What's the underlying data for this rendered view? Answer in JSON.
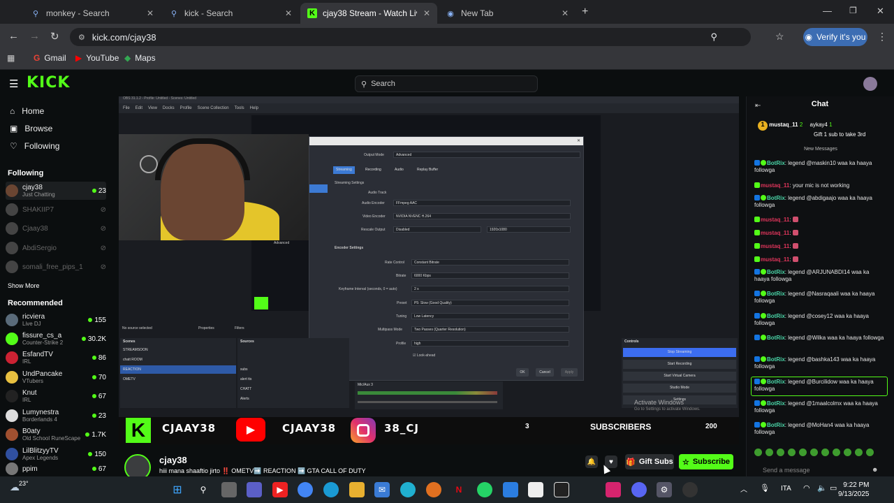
{
  "browser": {
    "tabs": [
      {
        "title": "monkey - Search",
        "icon": "search-icon"
      },
      {
        "title": "kick - Search",
        "icon": "search-icon"
      },
      {
        "title": "cjay38 Stream - Watch Live on",
        "icon": "kick-logo-icon"
      },
      {
        "title": "New Tab",
        "icon": "globe-icon"
      }
    ],
    "new_tab_symbol": "+",
    "url": "kick.com/cjay38",
    "verify_label": "Verify it's you",
    "bookmarks": [
      "Gmail",
      "YouTube",
      "Maps"
    ]
  },
  "kick": {
    "logo": "KICK",
    "search_placeholder": "Search",
    "nav": [
      {
        "label": "Home",
        "icon": "home-icon"
      },
      {
        "label": "Browse",
        "icon": "browse-icon"
      },
      {
        "label": "Following",
        "icon": "heart-icon"
      }
    ],
    "following_heading": "Following",
    "following": [
      {
        "name": "cjay38",
        "sub": "Just Chatting",
        "viewers": "23",
        "live": true
      },
      {
        "name": "SHAKIIP7",
        "sub": "",
        "viewers": "",
        "live": false
      },
      {
        "name": "Cjaay38",
        "sub": "",
        "viewers": "",
        "live": false
      },
      {
        "name": "AbdiSergio",
        "sub": "",
        "viewers": "",
        "live": false
      },
      {
        "name": "somali_free_pips_1",
        "sub": "",
        "viewers": "",
        "live": false
      }
    ],
    "show_more": "Show More",
    "recommended_heading": "Recommended",
    "recommended": [
      {
        "name": "ricviera",
        "sub": "Live DJ",
        "viewers": "155"
      },
      {
        "name": "fissure_cs_a",
        "sub": "Counter-Strike 2",
        "viewers": "30.2K"
      },
      {
        "name": "EsfandTV",
        "sub": "IRL",
        "viewers": "86"
      },
      {
        "name": "UndPancake",
        "sub": "VTubers",
        "viewers": "70"
      },
      {
        "name": "Knut",
        "sub": "IRL",
        "viewers": "67"
      },
      {
        "name": "Lumynestra",
        "sub": "Borderlands 4",
        "viewers": "23"
      },
      {
        "name": "B0aty",
        "sub": "Old School RuneScape",
        "viewers": "1.7K"
      },
      {
        "name": "LilBlitzyyTV",
        "sub": "Apex Legends",
        "viewers": "150"
      },
      {
        "name": "ppim",
        "sub": "",
        "viewers": "67"
      }
    ]
  },
  "stream": {
    "obs_title": "OBS 31.1.2 - Profile: Untitled - Scenes: Untitled",
    "obs_menu": [
      "File",
      "Edit",
      "View",
      "Docks",
      "Profile",
      "Scene Collection",
      "Tools",
      "Help"
    ],
    "dialog": {
      "output_mode_label": "Output Mode",
      "output_mode_value": "Advanced",
      "tabs": [
        "Streaming",
        "Recording",
        "Audio",
        "Replay Buffer"
      ],
      "streaming_settings": "Streaming Settings",
      "audio_track_label": "Audio Track",
      "audio_encoder_label": "Audio Encoder",
      "audio_encoder_value": "FFmpeg AAC",
      "video_encoder_label": "Video Encoder",
      "video_encoder_value": "NVIDIA NVENC H.264",
      "rescale_label": "Rescale Output",
      "rescale_value": "Disabled",
      "rescale_res": "1920x1080",
      "encoder_settings": "Encoder Settings",
      "rows": [
        {
          "label": "Rate Control",
          "value": "Constant Bitrate"
        },
        {
          "label": "Bitrate",
          "value": "6000 Kbps"
        },
        {
          "label": "Keyframe Interval (seconds, 0 = auto)",
          "value": "2 s"
        },
        {
          "label": "Preset",
          "value": "P5: Slow (Good Quality)"
        },
        {
          "label": "Tuning",
          "value": "Low Latency"
        },
        {
          "label": "Multipass Mode",
          "value": "Two Passes (Quarter Resolution)"
        },
        {
          "label": "Profile",
          "value": "high"
        }
      ],
      "lookahead": "Look-ahead",
      "ok": "OK",
      "cancel": "Cancel",
      "apply": "Apply",
      "advanced": "Advanced"
    },
    "no_source": "No source selected",
    "properties": "Properties",
    "filters": "Filters",
    "scenes_label": "Scenes",
    "scenes": [
      "STREAMSOON",
      "chatt ROOM",
      "REACTION",
      "OMETV"
    ],
    "active_scene": 2,
    "sources_label": "Sources",
    "sources": [
      "subs",
      "alert tts",
      "CHATT",
      "Alerts"
    ],
    "mixer_label": "Mic/Aux 3",
    "controls_label": "Controls",
    "controls": [
      "Stop Streaming",
      "Start Recording",
      "Start Virtual Camera",
      "Studio Mode",
      "Settings"
    ],
    "activate_windows": "Activate Windows",
    "activate_windows_sub": "Go to Settings to activate Windows.",
    "banner": {
      "kick_handle": "CJAAY38",
      "yt_handle": "CJAAY38",
      "ig_handle": "38_CJ",
      "count_left": "3",
      "subscribers": "SUBSCRIBERS",
      "count_right": "200"
    }
  },
  "channel": {
    "name": "cjay38",
    "title": "hiii mana shaaftio jirto ‼️ OMETV➡️ REACTION ➡️ GTA CALL OF DUTY",
    "gift_label": "Gift Subs",
    "subscribe_label": "Subscribe"
  },
  "chat": {
    "heading": "Chat",
    "pinned": {
      "user1": "mustaq_11",
      "count1": "2",
      "user2": "aykay4",
      "count2": "1",
      "text": "Gift 1 sub to take 3rd"
    },
    "new_messages": "New Messages",
    "messages": [
      {
        "user": "BotRix",
        "text": "legend @maskin10 waa ka haaya followga",
        "color": "#4ad6a8"
      },
      {
        "user": "mustaq_11",
        "text": "your mic is not working",
        "color": "#e0355b"
      },
      {
        "user": "BotRix",
        "text": "legend @abdigaajo waa ka haaya followga",
        "color": "#4ad6a8"
      },
      {
        "user": "mustaq_11",
        "text": "",
        "color": "#e0355b"
      },
      {
        "user": "mustaq_11",
        "text": "",
        "color": "#e0355b"
      },
      {
        "user": "mustaq_11",
        "text": "",
        "color": "#e0355b"
      },
      {
        "user": "mustaq_11",
        "text": "",
        "color": "#e0355b"
      },
      {
        "user": "BotRix",
        "text": "legend @ARJUNABDI14 waa ka haaya followga",
        "color": "#4ad6a8"
      },
      {
        "user": "BotRix",
        "text": "legend @Nasraqaali waa ka haaya followga",
        "color": "#4ad6a8"
      },
      {
        "user": "BotRix",
        "text": "legend @cosey12 waa ka haaya followga",
        "color": "#4ad6a8"
      },
      {
        "user": "BotRix",
        "text": "legend @Wilka waa ka haaya followga",
        "color": "#4ad6a8"
      },
      {
        "user": "BotRix",
        "text": "legend @bashka143 waa ka haaya followga",
        "color": "#4ad6a8"
      },
      {
        "user": "BotRix",
        "text": "legend @Burcilidow waa ka haaya followga",
        "color": "#4ad6a8"
      },
      {
        "user": "BotRix",
        "text": "legend @1maalcolmx waa ka haaya followga",
        "color": "#4ad6a8"
      },
      {
        "user": "BotRix",
        "text": "legend @MoHan4 waa ka haaya followga",
        "color": "#4ad6a8"
      }
    ],
    "send_placeholder": "Send a message"
  },
  "taskbar": {
    "temp": "23°",
    "lang": "ITA",
    "time": "9:22 PM",
    "date": "9/13/2025"
  },
  "colors": {
    "kick_green": "#53fc18",
    "bg": "#0b0e0f"
  }
}
